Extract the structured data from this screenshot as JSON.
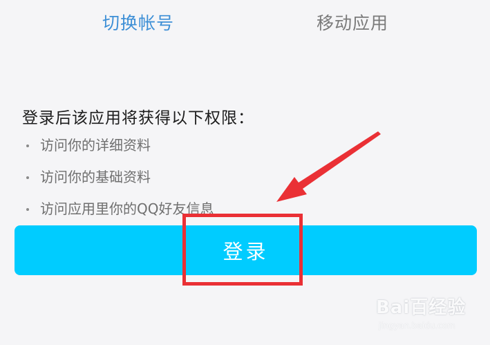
{
  "tabs": {
    "switch_account": "切换帐号",
    "mobile_app": "移动应用"
  },
  "permissions": {
    "title": "登录后该应用将获得以下权限：",
    "items": [
      "访问你的详细资料",
      "访问你的基础资料",
      "访问应用里你的QQ好友信息"
    ]
  },
  "login_button": {
    "label": "登录"
  },
  "annotation": {
    "box_color": "#ea3035",
    "arrow_color": "#ea3035"
  },
  "watermark": {
    "brand": "Bai百经验",
    "url": "jingyan.baidu.com"
  },
  "colors": {
    "accent": "#00ccff",
    "active_tab": "#3d8fd6"
  }
}
